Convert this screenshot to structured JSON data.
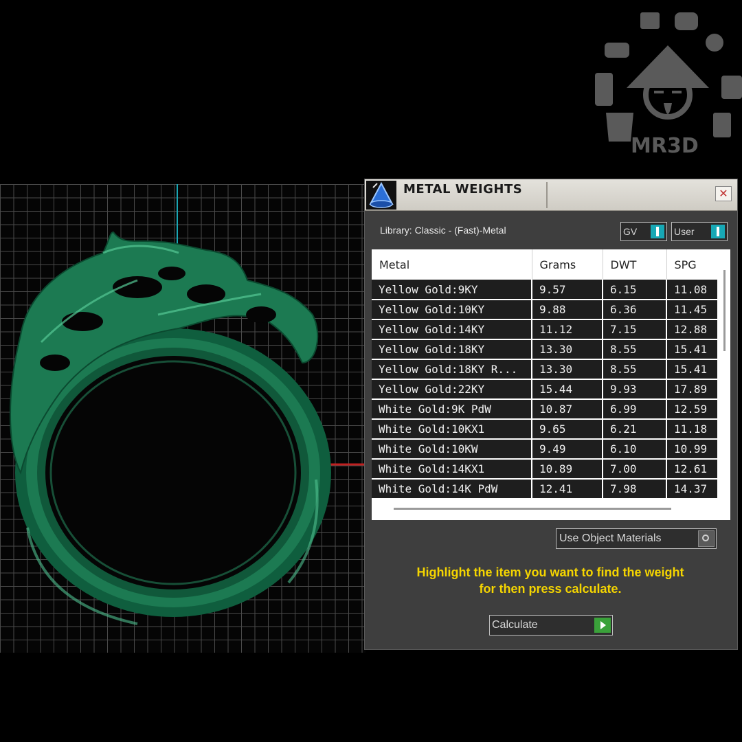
{
  "watermark": {
    "brand_text": "MR3D"
  },
  "viewport": {
    "object_color": "#1c7a52",
    "axis_y_color": "#1aa7b5",
    "axis_x_color": "#c02020"
  },
  "dialog": {
    "title": "METAL WEIGHTS",
    "close_glyph": "✕",
    "library_label": "Library: Classic - (Fast)-Metal",
    "toggle_gv_label": "GV",
    "toggle_user_label": "User",
    "columns": [
      "Metal",
      "Grams",
      "DWT",
      "SPG"
    ],
    "rows": [
      [
        "Yellow Gold:9KY",
        "9.57",
        "6.15",
        "11.08"
      ],
      [
        "Yellow Gold:10KY",
        "9.88",
        "6.36",
        "11.45"
      ],
      [
        "Yellow Gold:14KY",
        "11.12",
        "7.15",
        "12.88"
      ],
      [
        "Yellow Gold:18KY",
        "13.30",
        "8.55",
        "15.41"
      ],
      [
        "Yellow Gold:18KY R...",
        "13.30",
        "8.55",
        "15.41"
      ],
      [
        "Yellow Gold:22KY",
        "15.44",
        "9.93",
        "17.89"
      ],
      [
        "White Gold:9K PdW",
        "10.87",
        "6.99",
        "12.59"
      ],
      [
        "White Gold:10KX1",
        "9.65",
        "6.21",
        "11.18"
      ],
      [
        "White Gold:10KW",
        "9.49",
        "6.10",
        "10.99"
      ],
      [
        "White Gold:14KX1",
        "10.89",
        "7.00",
        "12.61"
      ],
      [
        "White Gold:14K PdW",
        "12.41",
        "7.98",
        "14.37"
      ]
    ],
    "use_object_materials_label": "Use Object Materials",
    "hint_line1": "Highlight the item you want to find the weight",
    "hint_line2": "for then press calculate.",
    "calculate_label": "Calculate",
    "accent_color": "#f5d500"
  }
}
